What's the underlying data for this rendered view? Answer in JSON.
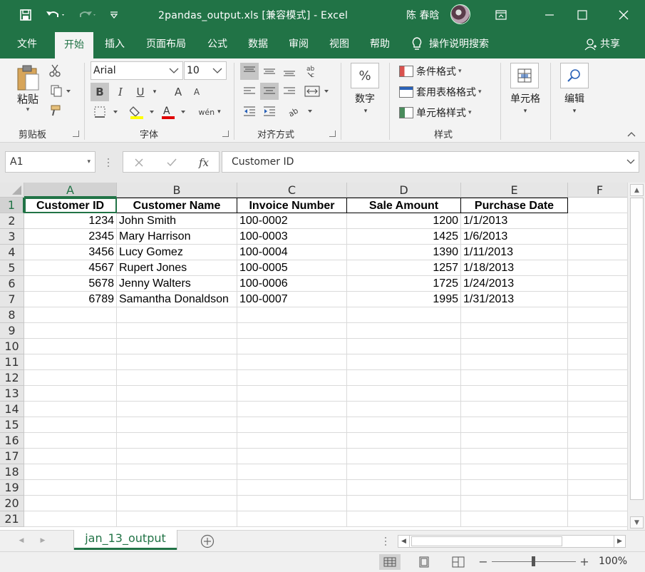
{
  "titlebar": {
    "title": "2pandas_output.xls  [兼容模式]  -  Excel",
    "user": "陈 春晗",
    "save_icon": "save-icon",
    "undo_icon": "undo-icon",
    "redo_icon": "redo-icon",
    "customize_icon": "customize-qat-icon"
  },
  "tabs": [
    {
      "label": "文件"
    },
    {
      "label": "开始"
    },
    {
      "label": "插入"
    },
    {
      "label": "页面布局"
    },
    {
      "label": "公式"
    },
    {
      "label": "数据"
    },
    {
      "label": "审阅"
    },
    {
      "label": "视图"
    },
    {
      "label": "帮助"
    }
  ],
  "tell_me": "操作说明搜索",
  "share": "共享",
  "ribbon": {
    "clipboard": {
      "paste": "粘贴",
      "label": "剪贴板"
    },
    "font": {
      "name": "Arial",
      "size": "10",
      "label": "字体",
      "bold": "B",
      "italic": "I",
      "underline": "U",
      "grow": "A",
      "shrink": "A",
      "phonetic": "wén"
    },
    "alignment": {
      "label": "对齐方式"
    },
    "number": {
      "label": "数字",
      "symbol": "%"
    },
    "styles": {
      "conditional": "条件格式",
      "table": "套用表格格式",
      "cell": "单元格样式",
      "label": "样式"
    },
    "cells": {
      "label": "单元格"
    },
    "editing": {
      "label": "编辑"
    }
  },
  "formula_bar": {
    "name_box": "A1",
    "fx": "fx",
    "content": "Customer ID"
  },
  "sheet": {
    "columns": [
      "A",
      "B",
      "C",
      "D",
      "E",
      "F"
    ],
    "rows": [
      "1",
      "2",
      "3",
      "4",
      "5",
      "6",
      "7",
      "8",
      "9",
      "10",
      "11",
      "12",
      "13",
      "14",
      "15",
      "16",
      "17",
      "18",
      "19",
      "20",
      "21"
    ],
    "headers": [
      "Customer ID",
      "Customer Name",
      "Invoice Number",
      "Sale Amount",
      "Purchase Date"
    ],
    "data": [
      [
        "1234",
        "John Smith",
        "100-0002",
        "1200",
        "1/1/2013"
      ],
      [
        "2345",
        "Mary Harrison",
        "100-0003",
        "1425",
        "1/6/2013"
      ],
      [
        "3456",
        "Lucy Gomez",
        "100-0004",
        "1390",
        "1/11/2013"
      ],
      [
        "4567",
        "Rupert Jones",
        "100-0005",
        "1257",
        "1/18/2013"
      ],
      [
        "5678",
        "Jenny Walters",
        "100-0006",
        "1725",
        "1/24/2013"
      ],
      [
        "6789",
        "Samantha Donaldson",
        "100-0007",
        "1995",
        "1/31/2013"
      ]
    ]
  },
  "sheet_tab": "jan_13_output",
  "status": {
    "zoom": "100%",
    "zoom_level": 100
  },
  "colors": {
    "accent": "#217346"
  }
}
